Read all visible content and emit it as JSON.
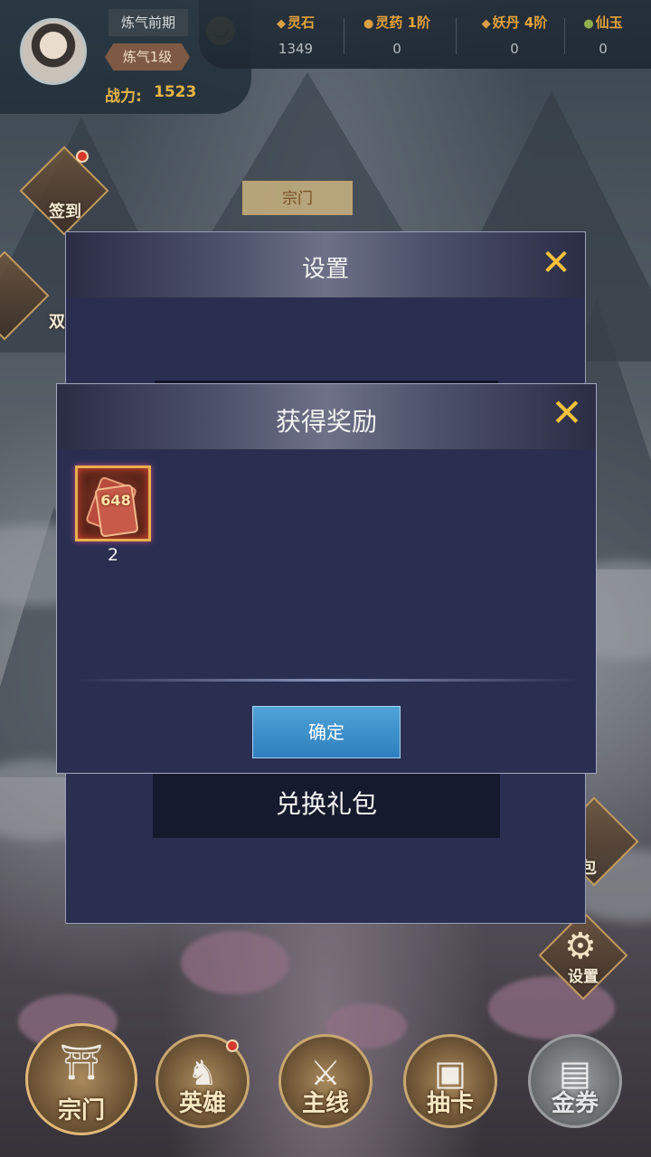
{
  "player": {
    "realm": "炼气前期",
    "level": "炼气1级",
    "power_label": "战力:",
    "power_value": "1523"
  },
  "resources": [
    {
      "name": "灵石",
      "value": "1349",
      "icon": "spirit-stone-icon"
    },
    {
      "name": "灵药 1阶",
      "value": "0",
      "icon": "herb-icon"
    },
    {
      "name": "妖丹 4阶",
      "value": "0",
      "icon": "demon-core-icon"
    },
    {
      "name": "仙玉",
      "value": "0",
      "icon": "jade-icon"
    }
  ],
  "side": {
    "checkin": "签到",
    "double": "双",
    "gift_pack": "包",
    "settings": "设置",
    "sect_tag": "宗门"
  },
  "settings_dialog": {
    "title": "设置",
    "redeem_label": "兑换礼包"
  },
  "reward_dialog": {
    "title": "获得奖励",
    "items": [
      {
        "value_text": "648",
        "count": "2",
        "icon": "recharge-card-icon"
      }
    ],
    "confirm_label": "确定"
  },
  "bottom_nav": [
    {
      "label": "宗门",
      "icon": "pagoda-icon",
      "active": true
    },
    {
      "label": "英雄",
      "icon": "hero-icon"
    },
    {
      "label": "主线",
      "icon": "crossed-swords-icon"
    },
    {
      "label": "抽卡",
      "icon": "treasure-box-icon"
    },
    {
      "label": "金券",
      "icon": "treasure-chest-icon",
      "locked": true
    }
  ],
  "colors": {
    "gold": "#e6b446",
    "dialog_bg": "#2a2f52",
    "confirm_blue": "#2e7fbe",
    "close_yellow": "#f5c13b"
  }
}
